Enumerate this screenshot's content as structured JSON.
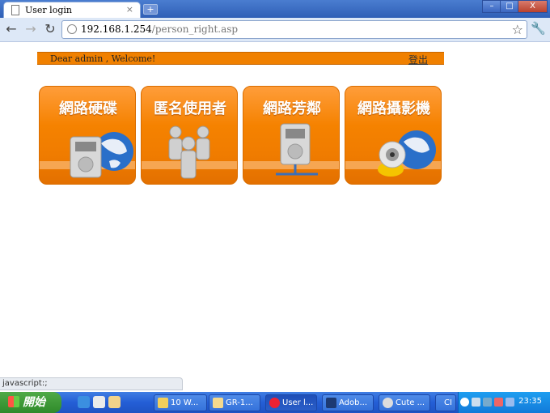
{
  "browser": {
    "tab_title": "User login",
    "tab_close": "×",
    "new_tab": "+",
    "url_host": "192.168.1.254",
    "url_path": "/person_right.asp",
    "window_buttons": {
      "minimize": "–",
      "maximize": "□",
      "close": "X"
    },
    "status_text": "javascript:;"
  },
  "page": {
    "welcome": "Dear admin , Welcome!",
    "logout": "登出",
    "tiles": [
      {
        "label": "網路硬碟",
        "icon": "globe-harddisk-icon"
      },
      {
        "label": "匿名使用者",
        "icon": "users-group-icon"
      },
      {
        "label": "網路芳鄰",
        "icon": "network-harddisk-icon"
      },
      {
        "label": "網路攝影機",
        "icon": "webcam-globe-icon"
      }
    ],
    "colors": {
      "accent": "#f08000",
      "tile_top": "#ff9d3a",
      "tile_bottom": "#e37000"
    }
  },
  "taskbar": {
    "start_label": "開始",
    "tasks": [
      {
        "label": "10 W..."
      },
      {
        "label": "GR-1..."
      },
      {
        "label": "User l..."
      },
      {
        "label": "Adob..."
      },
      {
        "label": "Cute ..."
      },
      {
        "label": "CI"
      }
    ],
    "clock": "23:35"
  }
}
